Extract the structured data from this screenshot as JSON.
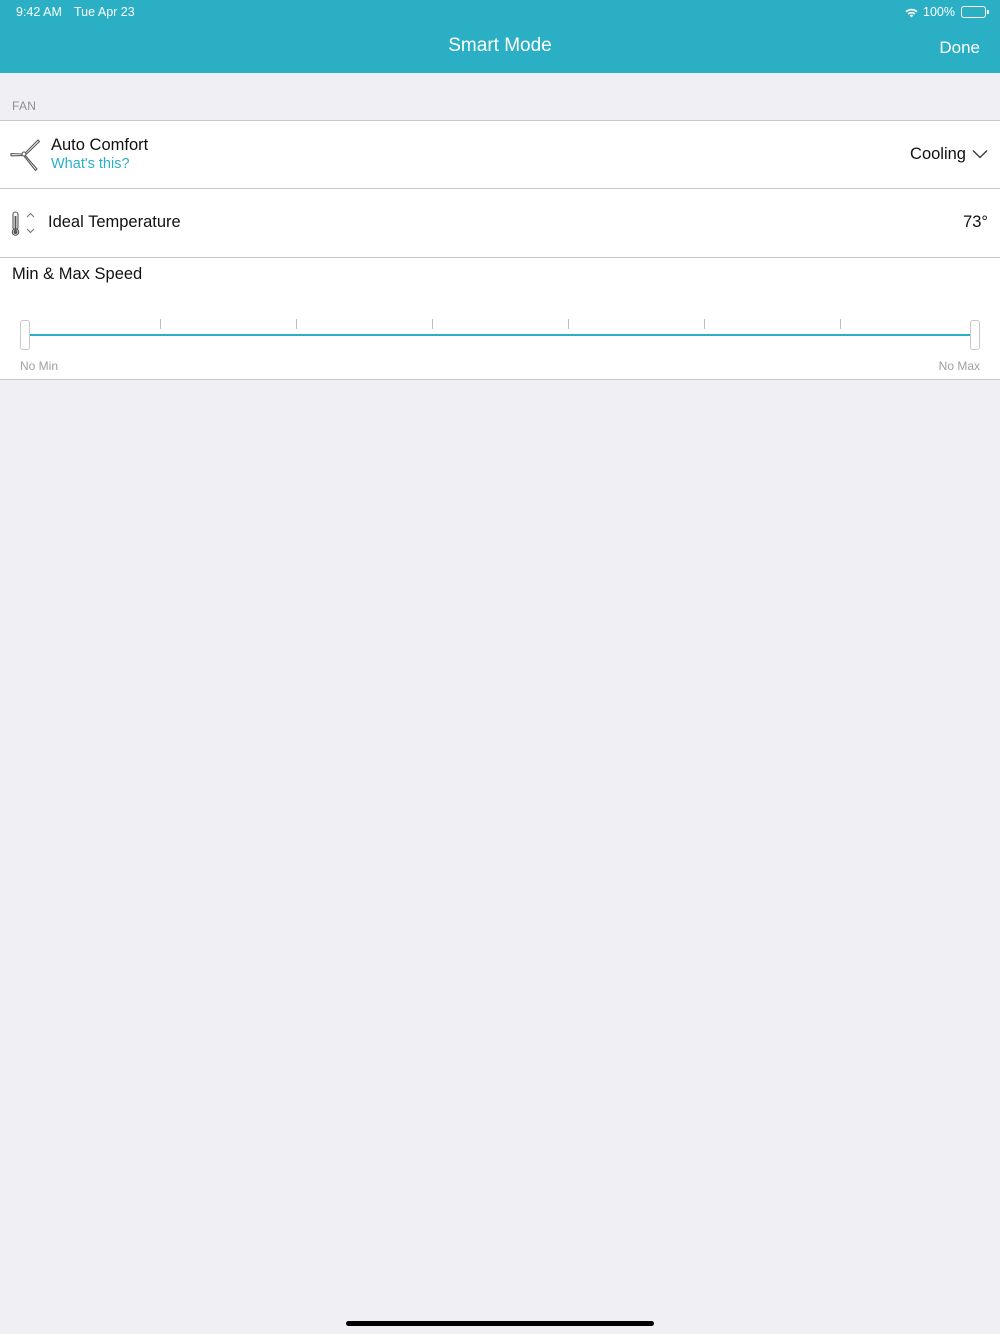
{
  "status_bar": {
    "time": "9:42 AM",
    "date": "Tue Apr 23",
    "battery": "100%",
    "icons": [
      "wifi-icon",
      "battery-icon"
    ]
  },
  "nav": {
    "title": "Smart Mode",
    "done_label": "Done"
  },
  "fan_section": {
    "header": "FAN",
    "auto_comfort": {
      "icon": "fan-icon",
      "title": "Auto Comfort",
      "help_link": "What's this?",
      "value": "Cooling",
      "dropdown_icon": "chevron-down-icon"
    },
    "ideal_temperature": {
      "icon": "thermometer-icon",
      "title": "Ideal Temperature",
      "value": "73°"
    },
    "speed": {
      "title": "Min & Max Speed",
      "min_label": "No Min",
      "max_label": "No Max",
      "tick_count": 6,
      "min_value": 0,
      "max_value": 7
    }
  },
  "colors": {
    "accent": "#2aafc5",
    "background": "#efeff4",
    "separator": "#c8c7cc",
    "secondary_text": "#8e8e93"
  }
}
